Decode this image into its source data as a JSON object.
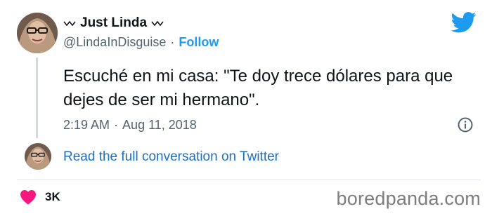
{
  "tweet": {
    "display_name": "Just Linda",
    "handle": "@LindaInDisguise",
    "separator": "·",
    "follow_label": "Follow",
    "text": "Escuché en mi casa: \"Te doy trece dólares para que dejes de ser mi hermano\".",
    "time": "2:19 AM",
    "date": "Aug 11, 2018",
    "read_conversation_label": "Read the full conversation on Twitter",
    "likes": "3K"
  },
  "icons": {
    "brand": "twitter-bird-icon",
    "info": "info-icon",
    "like": "heart-icon",
    "name_decoration": "squiggle-icon"
  },
  "watermark": "boredpanda.com",
  "colors": {
    "link": "#1d9bf0",
    "text": "#0f1419",
    "muted": "#536471",
    "heart": "#f91880"
  }
}
